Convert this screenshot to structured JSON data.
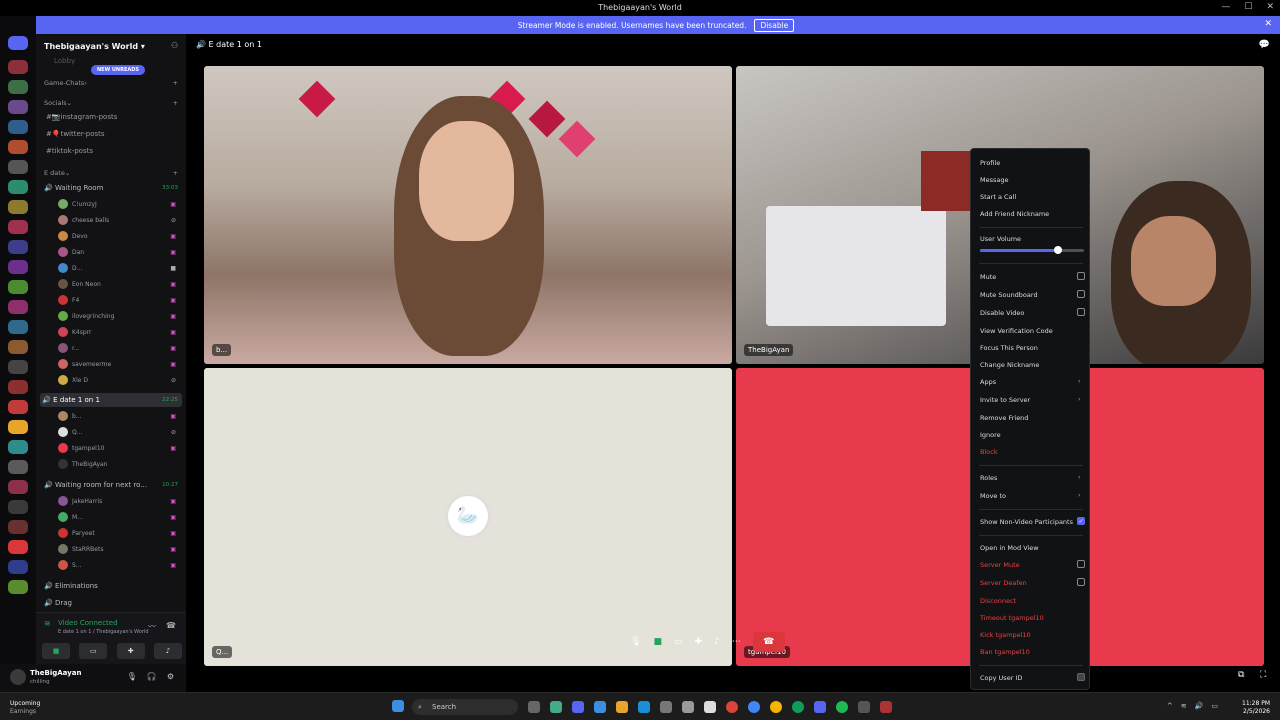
{
  "window": {
    "title": "Thebigaayan's World"
  },
  "banner": {
    "text": "Streamer Mode is enabled. Usernames have been truncated.",
    "disable_label": "Disable"
  },
  "sidebar": {
    "server_name": "Thebigaayan's World",
    "new_unreads": "NEW UNREADS",
    "lobby": "Lobby",
    "categories": {
      "game_chats": "Game-Chats",
      "socials": "Socials",
      "edate": "E date"
    },
    "text_channels": [
      {
        "name": "📷instagram-posts"
      },
      {
        "name": "🎈twitter-posts"
      },
      {
        "name": "tiktok-posts"
      }
    ],
    "waiting_room": {
      "name": "Waiting Room",
      "time": "33:03"
    },
    "waiting_users": [
      "C!umzyJ",
      "cheese balls",
      "Devo",
      "Dan",
      "D...",
      "Eon Neon",
      "F4",
      "ilovegrinching",
      "K4sprr",
      "r...",
      "savemeerme",
      "Xle D"
    ],
    "edate_channel": {
      "name": "E date 1 on 1",
      "time": "22:25"
    },
    "edate_users": [
      "b...",
      "Q...",
      "tgampel10",
      "TheBigAyan"
    ],
    "next_room": {
      "name": "Waiting room for next ro...",
      "time": "10:27"
    },
    "next_users": [
      "JakeHarris",
      "M...",
      "Paryeet",
      "StaRRBets",
      "S..."
    ],
    "eliminations": "Eliminations",
    "drag": "Drag"
  },
  "voice": {
    "status": "Video Connected",
    "location": "E date 1 on 1 / Thebigaayan's World"
  },
  "user": {
    "name": "TheBigAayan",
    "status": "chilling"
  },
  "channel": {
    "title": "E date 1 on 1"
  },
  "tiles": {
    "t1_label": "b...",
    "t2_label": "TheBigAyan",
    "t3_label": "Q...",
    "t4_label": "tgampel10"
  },
  "context_menu": {
    "profile": "Profile",
    "message": "Message",
    "start_call": "Start a Call",
    "add_nickname": "Add Friend Nickname",
    "user_volume": "User Volume",
    "volume_level": 0.75,
    "mute": "Mute",
    "mute_soundboard": "Mute Soundboard",
    "disable_video": "Disable Video",
    "view_code": "View Verification Code",
    "focus": "Focus This Person",
    "change_nickname": "Change Nickname",
    "apps": "Apps",
    "invite": "Invite to Server",
    "remove_friend": "Remove Friend",
    "ignore": "Ignore",
    "block": "Block",
    "roles": "Roles",
    "move_to": "Move to",
    "show_non_video": "Show Non-Video Participants",
    "open_mod_view": "Open in Mod View",
    "server_mute": "Server Mute",
    "server_deafen": "Server Deafen",
    "disconnect": "Disconnect",
    "timeout": "Timeout tgampel10",
    "kick": "Kick tgampel10",
    "ban": "Ban tgampel10",
    "copy_id": "Copy User ID"
  },
  "taskbar": {
    "weather_title": "Upcoming",
    "weather_sub": "Earnings",
    "search": "Search",
    "time": "11:28 PM",
    "date": "2/5/2026"
  }
}
